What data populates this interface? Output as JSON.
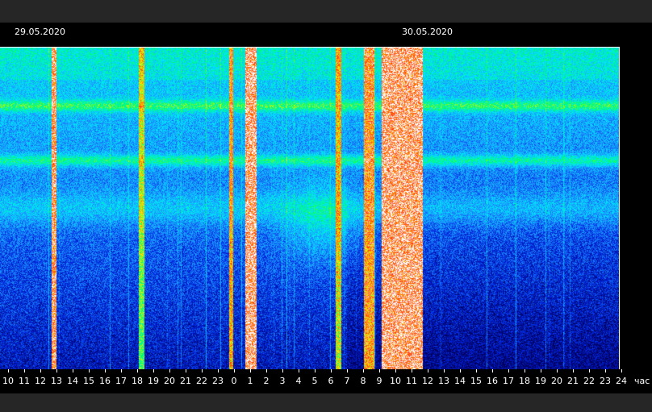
{
  "header": {
    "dates": [
      "29.05.2020",
      "30.05.2020"
    ]
  },
  "chart_data": {
    "type": "heatmap",
    "title": "",
    "xlabel": "час",
    "ylabel": "",
    "x_ticks": [
      "10",
      "11",
      "12",
      "13",
      "14",
      "15",
      "16",
      "17",
      "18",
      "19",
      "20",
      "21",
      "22",
      "23",
      "0",
      "1",
      "2",
      "3",
      "4",
      "5",
      "6",
      "7",
      "8",
      "9",
      "10",
      "11",
      "12",
      "13",
      "14",
      "15",
      "16",
      "17",
      "18",
      "19",
      "20",
      "21",
      "22",
      "23",
      "24"
    ],
    "xlim_hours": [
      9.6,
      33.9
    ],
    "date_markers": [
      {
        "label": "29.05.2020",
        "hour": 9.9
      },
      {
        "label": "30.05.2020",
        "hour": 34.5
      }
    ],
    "colormap": [
      "#00005a",
      "#0022dd",
      "#1e90ff",
      "#00e5ff",
      "#00ff66",
      "#ffee00",
      "#ff3300",
      "#ffffff"
    ],
    "y_ticks": [],
    "grid": false,
    "legend": "none",
    "features": {
      "saturated_bursts_hours": [
        {
          "start": 19.25,
          "end": 19.65,
          "intensity": 1.0
        },
        {
          "start": 24.6,
          "end": 26.2,
          "intensity": 1.0
        },
        {
          "start": 23.9,
          "end": 24.3,
          "intensity": 0.85
        },
        {
          "start": 22.8,
          "end": 23.0,
          "intensity": 0.7
        },
        {
          "start": 11.65,
          "end": 11.8,
          "intensity": 0.95
        },
        {
          "start": 18.6,
          "end": 18.75,
          "intensity": 0.8
        },
        {
          "start": 15.05,
          "end": 15.25,
          "intensity": 0.6
        }
      ],
      "resonance_bands_relative_height": [
        0.18,
        0.35,
        0.5
      ],
      "note_text": ""
    }
  }
}
